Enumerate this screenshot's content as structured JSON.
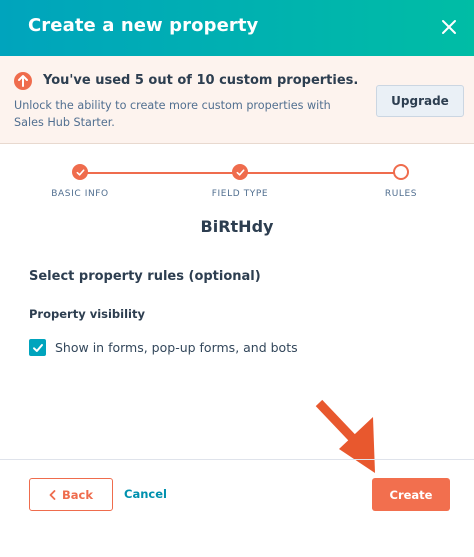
{
  "header": {
    "title": "Create a new property"
  },
  "banner": {
    "headline": "You've used 5 out of 10 custom properties.",
    "body": "Unlock the ability to create more custom properties with Sales Hub Starter.",
    "upgrade_label": "Upgrade"
  },
  "stepper": {
    "steps": [
      {
        "label": "BASIC INFO",
        "status": "complete"
      },
      {
        "label": "FIELD TYPE",
        "status": "complete"
      },
      {
        "label": "RULES",
        "status": "current"
      }
    ]
  },
  "property_name": "BiRtHdy",
  "rules": {
    "section_title": "Select property rules (optional)",
    "visibility_label": "Property visibility",
    "show_in_forms_label": "Show in forms, pop-up forms, and bots",
    "show_in_forms_checked": true
  },
  "footer": {
    "back_label": "Back",
    "cancel_label": "Cancel",
    "create_label": "Create"
  },
  "colors": {
    "header_start": "#00a4bd",
    "header_end": "#00bda5",
    "accent": "#ef6c4d",
    "checkbox": "#00a4bd",
    "link": "#0091ae"
  }
}
